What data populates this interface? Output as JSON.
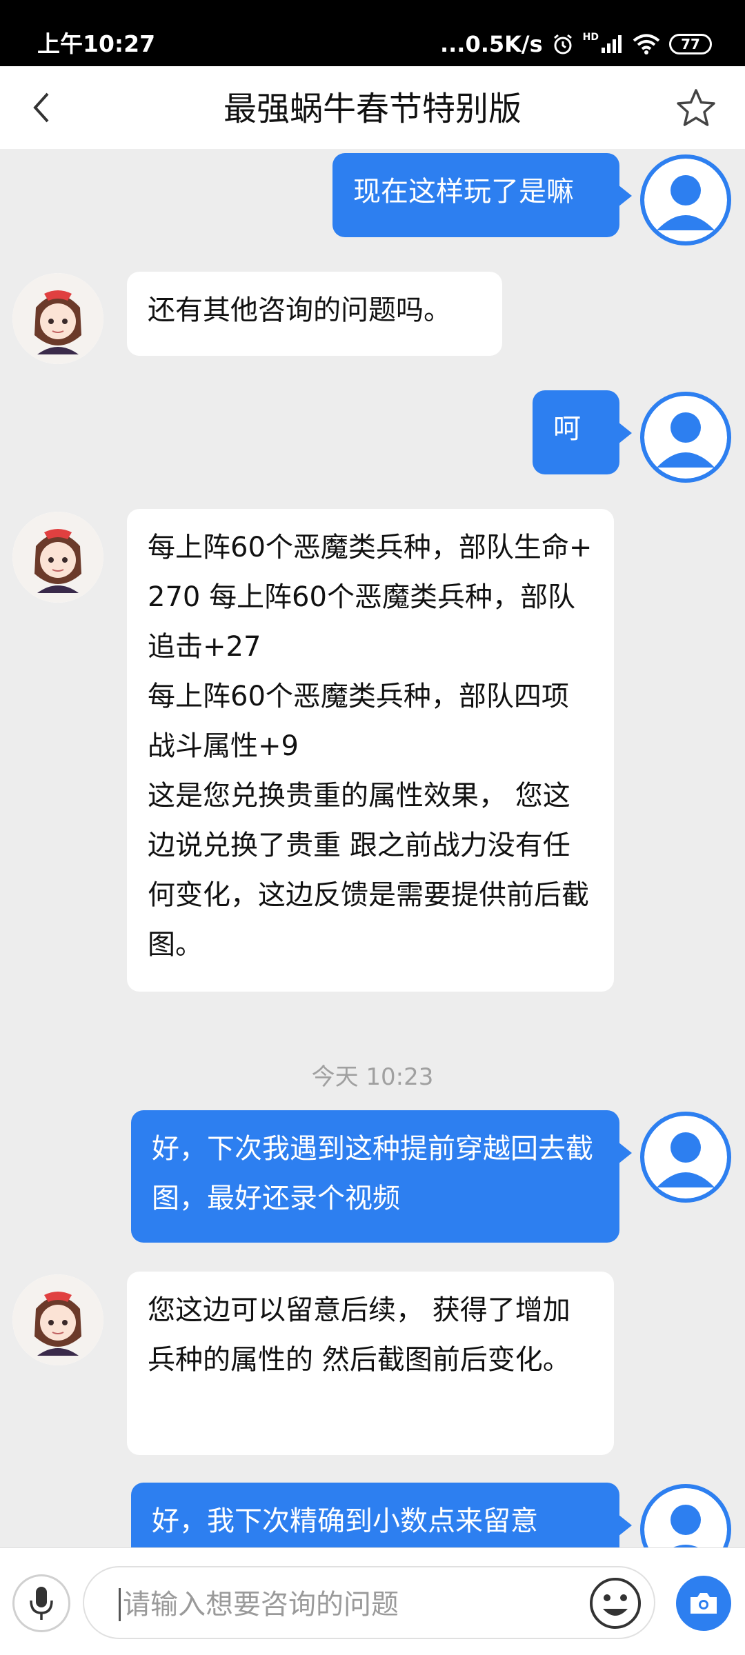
{
  "status_bar": {
    "time": "上午10:27",
    "network_speed": "...0.5K/s",
    "hd_label": "HD",
    "battery": "77",
    "icons": [
      "alarm-icon",
      "signal-icon",
      "wifi-icon",
      "battery-icon"
    ]
  },
  "header": {
    "title": "最强蜗牛春节特别版",
    "back_icon": "chevron-left-icon",
    "favorite_icon": "star-outline-icon"
  },
  "messages": [
    {
      "from": "user",
      "text": "现在这样玩了是嘛"
    },
    {
      "from": "agent",
      "text": "还有其他咨询的问题吗。"
    },
    {
      "from": "user",
      "text": "呵"
    },
    {
      "from": "agent",
      "text": "每上阵60个恶魔类兵种，部队生命+270 每上阵60个恶魔类兵种，部队追击+27\n每上阵60个恶魔类兵种，部队四项战斗属性+9\n这是您兑换贵重的属性效果， 您这边说兑换了贵重 跟之前战力没有任何变化，这边反馈是需要提供前后截图。"
    },
    {
      "from": "user",
      "text": "好，下次我遇到这种提前穿越回去截图，最好还录个视频"
    },
    {
      "from": "agent",
      "text": "您这边可以留意后续， 获得了增加兵种的属性的 然后截图前后变化。"
    },
    {
      "from": "user",
      "text": "好，我下次精确到小数点来留意"
    }
  ],
  "timestamp": "今天 10:23",
  "input": {
    "placeholder": "请输入想要咨询的问题",
    "value": ""
  },
  "colors": {
    "accent": "#2d7ff0",
    "background": "#ededed",
    "bubble_agent": "#ffffff"
  }
}
